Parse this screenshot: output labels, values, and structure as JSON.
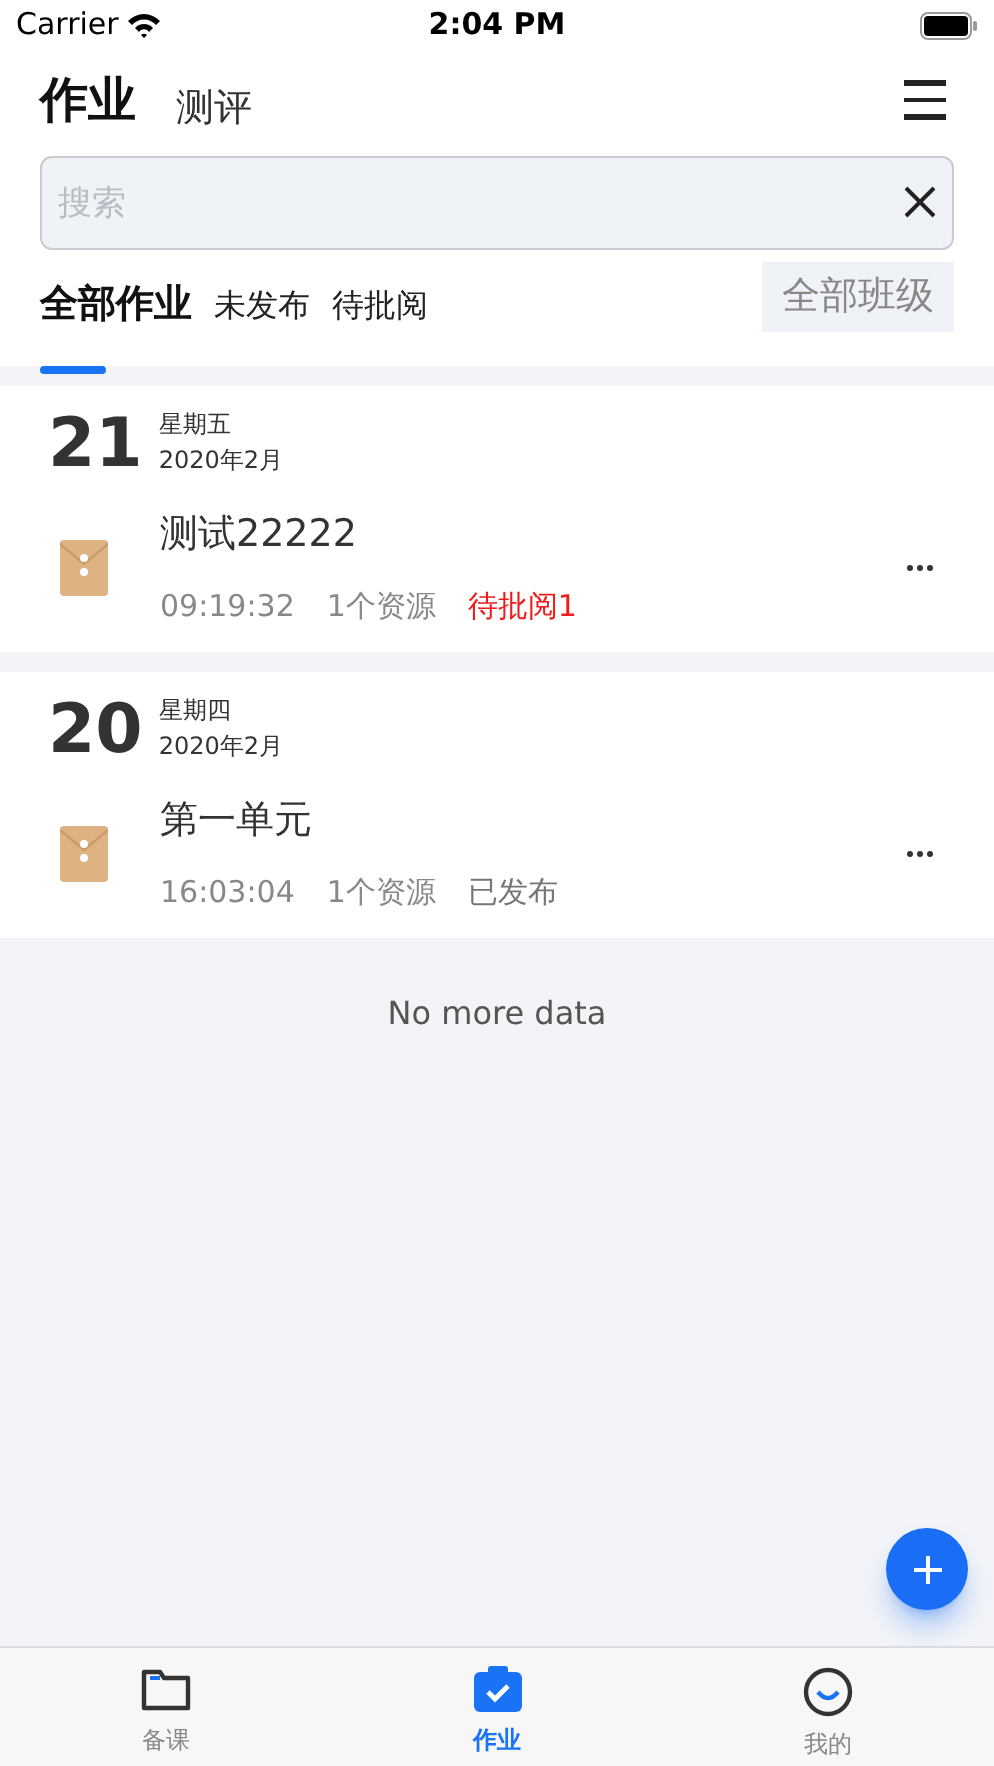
{
  "status_bar": {
    "carrier": "Carrier",
    "time": "2:04 PM"
  },
  "header": {
    "tabs": [
      {
        "label": "作业",
        "selected": true
      },
      {
        "label": "测评",
        "selected": false
      }
    ]
  },
  "search": {
    "placeholder": "搜索"
  },
  "filters": [
    {
      "label": "全部作业",
      "selected": true
    },
    {
      "label": "未发布",
      "selected": false
    },
    {
      "label": "待批阅",
      "selected": false
    }
  ],
  "class_filter": "全部班级",
  "groups": [
    {
      "day": "21",
      "weekday": "星期五",
      "month": "2020年2月",
      "items": [
        {
          "title": "测试22222",
          "time": "09:19:32",
          "resources": "1个资源",
          "status": "待批阅1",
          "kind": "pending"
        }
      ]
    },
    {
      "day": "20",
      "weekday": "星期四",
      "month": "2020年2月",
      "items": [
        {
          "title": "第一单元",
          "time": "16:03:04",
          "resources": "1个资源",
          "status": "已发布",
          "kind": "published"
        }
      ]
    }
  ],
  "footer_note": "No more data",
  "tab_bar": [
    {
      "label": "备课",
      "selected": false,
      "kind": "folder"
    },
    {
      "label": "作业",
      "selected": true,
      "kind": "clipboard"
    },
    {
      "label": "我的",
      "selected": false,
      "kind": "smile"
    }
  ]
}
